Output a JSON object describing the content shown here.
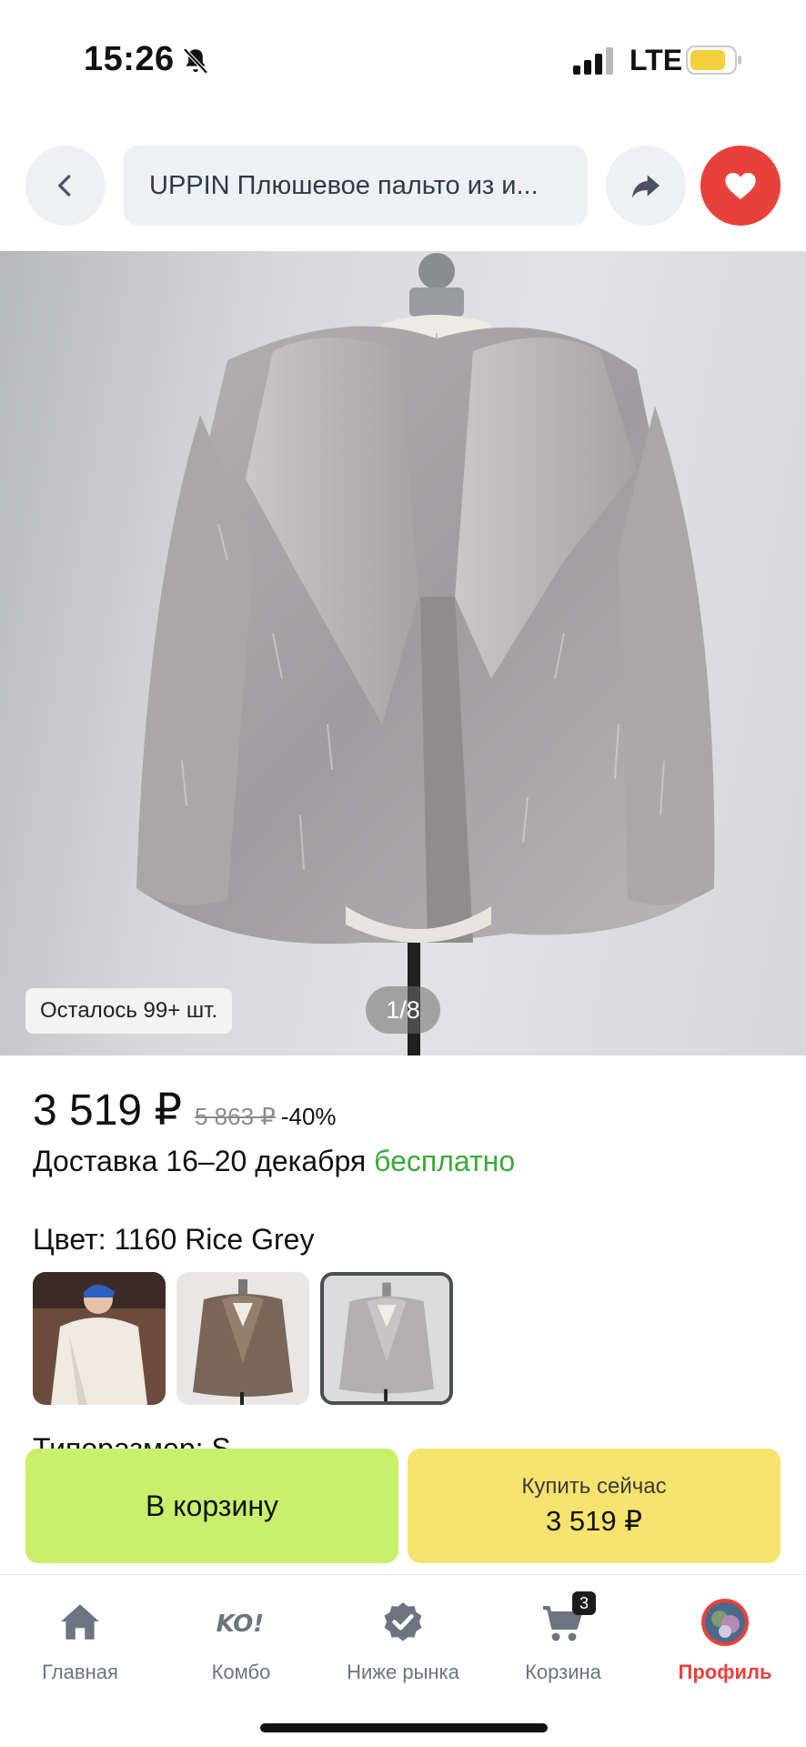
{
  "status_bar": {
    "time": "15:26",
    "network": "LTE",
    "icons": [
      "bell-slash-icon",
      "signal-icon",
      "battery-icon"
    ],
    "battery_color": "#f5cf3c"
  },
  "top_nav": {
    "search_text": "UPPIN Плюшевое пальто из и...",
    "icons": [
      "chevron-left-icon",
      "share-arrow-icon",
      "heart-icon"
    ],
    "favorite_color": "#e8413a"
  },
  "product": {
    "image_alt": "fur-coat-photo",
    "stock_label": "Осталось 99+ шт.",
    "page_indicator": "1/8",
    "price": "3 519 ₽",
    "old_price": "5 863 ₽",
    "discount": "-40%",
    "delivery_prefix": "Доставка 16–20 декабря",
    "delivery_free": "бесплатно",
    "color_label": "Цвет: 1160 Rice Grey",
    "size_label": "Типоразмер: S",
    "swatches": [
      "white-fur-swatch",
      "brown-fur-swatch",
      "grey-fur-swatch"
    ]
  },
  "actions": {
    "cart_label": "В корзину",
    "buy_label": "Купить сейчас",
    "buy_price": "3 519 ₽",
    "cart_color": "#c9f06a",
    "buy_color": "#f7e46e"
  },
  "bottom_nav": {
    "items": [
      {
        "label": "Главная",
        "icon": "home-icon"
      },
      {
        "label": "Комбо",
        "icon": "ko-icon"
      },
      {
        "label": "Ниже рынка",
        "icon": "badge-check-icon"
      },
      {
        "label": "Корзина",
        "icon": "cart-icon",
        "badge": "3"
      },
      {
        "label": "Профиль",
        "icon": "avatar-icon",
        "active": true
      }
    ],
    "active_color": "#e8413a"
  }
}
